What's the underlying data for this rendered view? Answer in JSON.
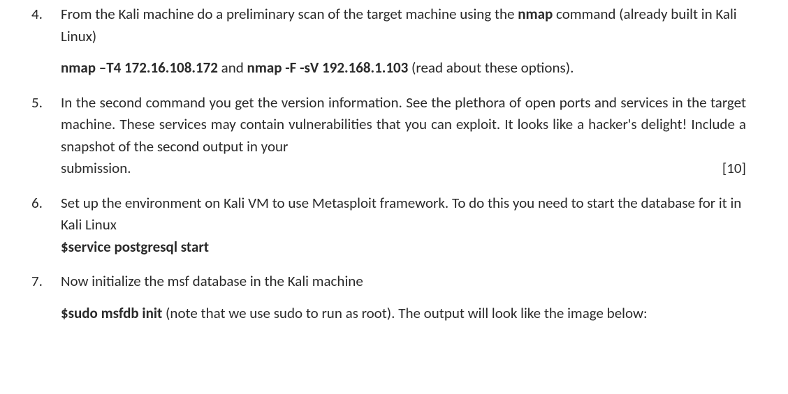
{
  "items": [
    {
      "num": "4.",
      "p1_a": "From the Kali machine do a preliminary scan of the target machine using the ",
      "p1_b": "nmap",
      "p1_c": " command (already built in Kali Linux)",
      "p2_a": "nmap –T4 172.16.108.172",
      "p2_b": " and ",
      "p2_c": "nmap -F -sV 192.168.1.103",
      "p2_d": "  (read about these options)."
    },
    {
      "num": "5.",
      "p1_main": "In the second command you get the version information. See the plethora of open ports and services in the target machine. These services may contain vulnerabilities that you can exploit. It looks like a hacker's delight! Include a snapshot of the second output in your ",
      "p1_lastword": "submission.",
      "p1_points": "[10]"
    },
    {
      "num": "6.",
      "p1": "Set up the environment on Kali VM to use Metasploit framework. To do this you need to start the database for it in Kali Linux",
      "p2": "$service postgresql start"
    },
    {
      "num": "7.",
      "p1": "Now initialize the msf database in the Kali machine",
      "p2_a": "$sudo msfdb init",
      "p2_b": "  (note that we use sudo to run as root). The output will look like the image below:"
    }
  ]
}
